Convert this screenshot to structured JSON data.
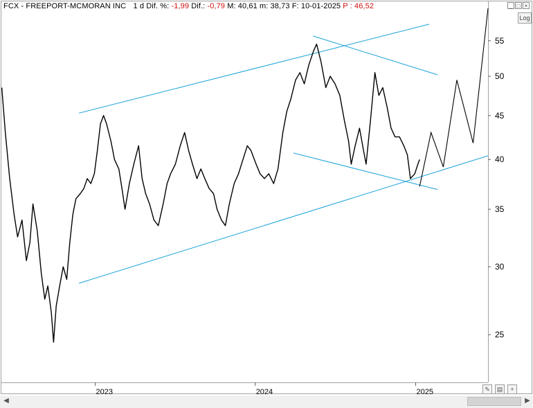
{
  "header": {
    "symbol": "FCX - FREEPORT-MCMORAN INC",
    "period": "1 d",
    "dif_pct_label": "Dif. %:",
    "dif_pct_value": "-1,99",
    "dif_label": "Dif.:",
    "dif_value": "-0,79",
    "m_label": "M:",
    "m_value": "40,61",
    "mlow_label": "m:",
    "mlow_value": "38,73",
    "f_label": "F:",
    "f_value": "10-01-2025",
    "p_label": "P :",
    "p_value": "46,52"
  },
  "log_button": "Log",
  "colors": {
    "price": "#000000",
    "trendlines": "#1aa3d9",
    "negative": "#d01010",
    "axis": "#a0a0a0"
  },
  "chart_data": {
    "type": "line",
    "title": "FCX - FREEPORT-MCMORAN INC",
    "yscale": "log",
    "ylim": [
      22,
      60
    ],
    "y_ticks": [
      25,
      30,
      35,
      40,
      45,
      50,
      55
    ],
    "x_ticks": [
      "2023",
      "2024",
      "2025"
    ],
    "x_start": "2022-06-01",
    "x_end": "2025-06-15",
    "grid": false,
    "series": [
      {
        "name": "",
        "values_xy": [
          [
            "2022-06-02",
            48.5
          ],
          [
            "2022-06-10",
            43
          ],
          [
            "2022-06-20",
            38
          ],
          [
            "2022-06-30",
            34.5
          ],
          [
            "2022-07-08",
            32.5
          ],
          [
            "2022-07-18",
            34
          ],
          [
            "2022-07-28",
            30.5
          ],
          [
            "2022-08-05",
            32
          ],
          [
            "2022-08-12",
            35.5
          ],
          [
            "2022-08-22",
            33
          ],
          [
            "2022-08-31",
            29.5
          ],
          [
            "2022-09-08",
            27.5
          ],
          [
            "2022-09-15",
            28.5
          ],
          [
            "2022-09-23",
            26.5
          ],
          [
            "2022-09-28",
            24.5
          ],
          [
            "2022-10-04",
            27
          ],
          [
            "2022-10-12",
            28.5
          ],
          [
            "2022-10-20",
            30
          ],
          [
            "2022-10-28",
            29
          ],
          [
            "2022-11-04",
            32
          ],
          [
            "2022-11-11",
            34.5
          ],
          [
            "2022-11-18",
            36
          ],
          [
            "2022-11-28",
            36.5
          ],
          [
            "2022-12-06",
            37
          ],
          [
            "2022-12-14",
            38
          ],
          [
            "2022-12-22",
            37.5
          ],
          [
            "2022-12-30",
            38.5
          ],
          [
            "2023-01-06",
            41
          ],
          [
            "2023-01-13",
            44
          ],
          [
            "2023-01-20",
            45
          ],
          [
            "2023-01-27",
            44
          ],
          [
            "2023-02-06",
            42
          ],
          [
            "2023-02-14",
            40
          ],
          [
            "2023-02-24",
            39
          ],
          [
            "2023-03-03",
            37
          ],
          [
            "2023-03-10",
            35
          ],
          [
            "2023-03-20",
            37.5
          ],
          [
            "2023-03-30",
            39.5
          ],
          [
            "2023-04-10",
            41.5
          ],
          [
            "2023-04-18",
            38
          ],
          [
            "2023-04-26",
            36.5
          ],
          [
            "2023-05-05",
            35.5
          ],
          [
            "2023-05-15",
            34
          ],
          [
            "2023-05-25",
            33.5
          ],
          [
            "2023-06-05",
            35.5
          ],
          [
            "2023-06-14",
            37.5
          ],
          [
            "2023-06-22",
            38.5
          ],
          [
            "2023-07-03",
            39.5
          ],
          [
            "2023-07-14",
            41.5
          ],
          [
            "2023-07-24",
            43
          ],
          [
            "2023-08-02",
            41
          ],
          [
            "2023-08-11",
            39.5
          ],
          [
            "2023-08-21",
            38
          ],
          [
            "2023-08-30",
            39
          ],
          [
            "2023-09-08",
            38
          ],
          [
            "2023-09-18",
            37
          ],
          [
            "2023-09-28",
            36.5
          ],
          [
            "2023-10-06",
            35
          ],
          [
            "2023-10-16",
            34
          ],
          [
            "2023-10-25",
            33.5
          ],
          [
            "2023-11-03",
            35.5
          ],
          [
            "2023-11-14",
            37.5
          ],
          [
            "2023-11-24",
            38.5
          ],
          [
            "2023-12-04",
            40
          ],
          [
            "2023-12-14",
            41.5
          ],
          [
            "2023-12-22",
            41
          ],
          [
            "2024-01-03",
            39.5
          ],
          [
            "2024-01-12",
            38.5
          ],
          [
            "2024-01-22",
            38
          ],
          [
            "2024-02-01",
            38.5
          ],
          [
            "2024-02-12",
            37.5
          ],
          [
            "2024-02-22",
            39
          ],
          [
            "2024-03-04",
            43
          ],
          [
            "2024-03-13",
            45.5
          ],
          [
            "2024-03-22",
            47
          ],
          [
            "2024-04-02",
            49.5
          ],
          [
            "2024-04-12",
            50.5
          ],
          [
            "2024-04-22",
            49
          ],
          [
            "2024-05-02",
            51.5
          ],
          [
            "2024-05-13",
            53.5
          ],
          [
            "2024-05-20",
            54.5
          ],
          [
            "2024-05-30",
            52
          ],
          [
            "2024-06-10",
            48.5
          ],
          [
            "2024-06-20",
            50
          ],
          [
            "2024-07-01",
            49
          ],
          [
            "2024-07-12",
            47.5
          ],
          [
            "2024-07-22",
            44.5
          ],
          [
            "2024-08-01",
            42
          ],
          [
            "2024-08-07",
            39.5
          ],
          [
            "2024-08-16",
            41.5
          ],
          [
            "2024-08-26",
            43.5
          ],
          [
            "2024-09-04",
            41
          ],
          [
            "2024-09-10",
            39.5
          ],
          [
            "2024-09-20",
            44.5
          ],
          [
            "2024-09-30",
            50.5
          ],
          [
            "2024-10-09",
            47.5
          ],
          [
            "2024-10-18",
            48.5
          ],
          [
            "2024-10-28",
            46
          ],
          [
            "2024-11-06",
            43.5
          ],
          [
            "2024-11-15",
            42.5
          ],
          [
            "2024-11-25",
            42.5
          ],
          [
            "2024-12-05",
            41.5
          ],
          [
            "2024-12-13",
            40.5
          ],
          [
            "2024-12-20",
            38
          ],
          [
            "2024-12-30",
            38.5
          ],
          [
            "2025-01-06",
            39.5
          ],
          [
            "2025-01-10",
            40
          ]
        ]
      },
      {
        "name": "",
        "values_xy": [
          [
            "2025-01-10",
            37.2
          ],
          [
            "2025-02-05",
            43
          ],
          [
            "2025-03-05",
            39.2
          ],
          [
            "2025-04-05",
            49.5
          ],
          [
            "2025-05-12",
            41.8
          ],
          [
            "2025-06-15",
            60
          ]
        ]
      },
      {
        "name": "",
        "values_xy": [
          [
            "2022-11-25",
            28.7
          ],
          [
            "2025-06-15",
            40.4
          ]
        ]
      },
      {
        "name": "",
        "values_xy": [
          [
            "2022-11-25",
            45.3
          ],
          [
            "2025-02-01",
            57.5
          ]
        ]
      },
      {
        "name": "",
        "values_xy": [
          [
            "2024-05-12",
            55.7
          ],
          [
            "2025-02-20",
            50.2
          ]
        ]
      },
      {
        "name": "",
        "values_xy": [
          [
            "2024-03-28",
            40.7
          ],
          [
            "2025-02-20",
            36.9
          ]
        ]
      }
    ]
  }
}
